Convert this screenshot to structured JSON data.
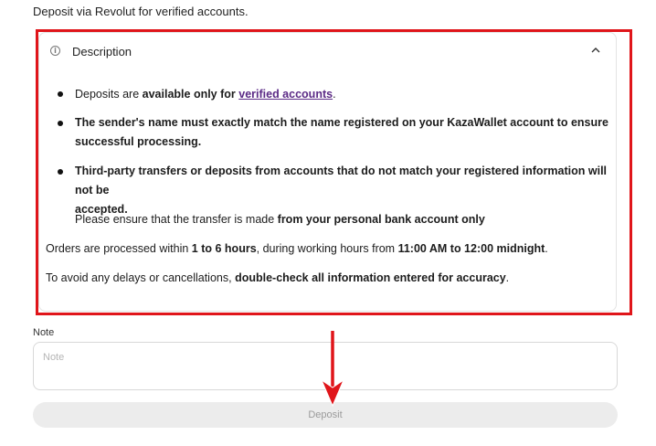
{
  "intro_text": "Deposit via Revolut for verified accounts.",
  "description": {
    "header": "Description",
    "info_icon": "info-circle-icon",
    "toggle_icon": "chevron-up-icon",
    "bullets": [
      {
        "pre": "Deposits are ",
        "bold": "available only for ",
        "link": "verified accounts",
        "post": "."
      },
      {
        "bold_line1": "The sender's name must exactly match the name registered on your KazaWallet account to ensure",
        "bold_line2": "successful processing."
      },
      {
        "bold_line1": "Third-party transfers or deposits from accounts that do not match your registered information will not be",
        "bold_line2": "accepted."
      }
    ],
    "ensure": {
      "pre": "Please ensure that the transfer is made ",
      "bold": "from your personal bank account only"
    },
    "orders": {
      "p1": "Orders are processed within ",
      "b1": "1 to 6 hours",
      "p2": ", during working hours from ",
      "b2": "11:00 AM to 12:00 midnight",
      "p3": "."
    },
    "avoid": {
      "p1": "To avoid any delays or cancellations, ",
      "b1": "double-check all information entered for accuracy",
      "p2": "."
    }
  },
  "note": {
    "label": "Note",
    "placeholder": "Note",
    "value": ""
  },
  "deposit_button": "Deposit",
  "colors": {
    "highlight": "#e0151a",
    "link": "#5b2a86",
    "button_bg": "#ececec"
  }
}
